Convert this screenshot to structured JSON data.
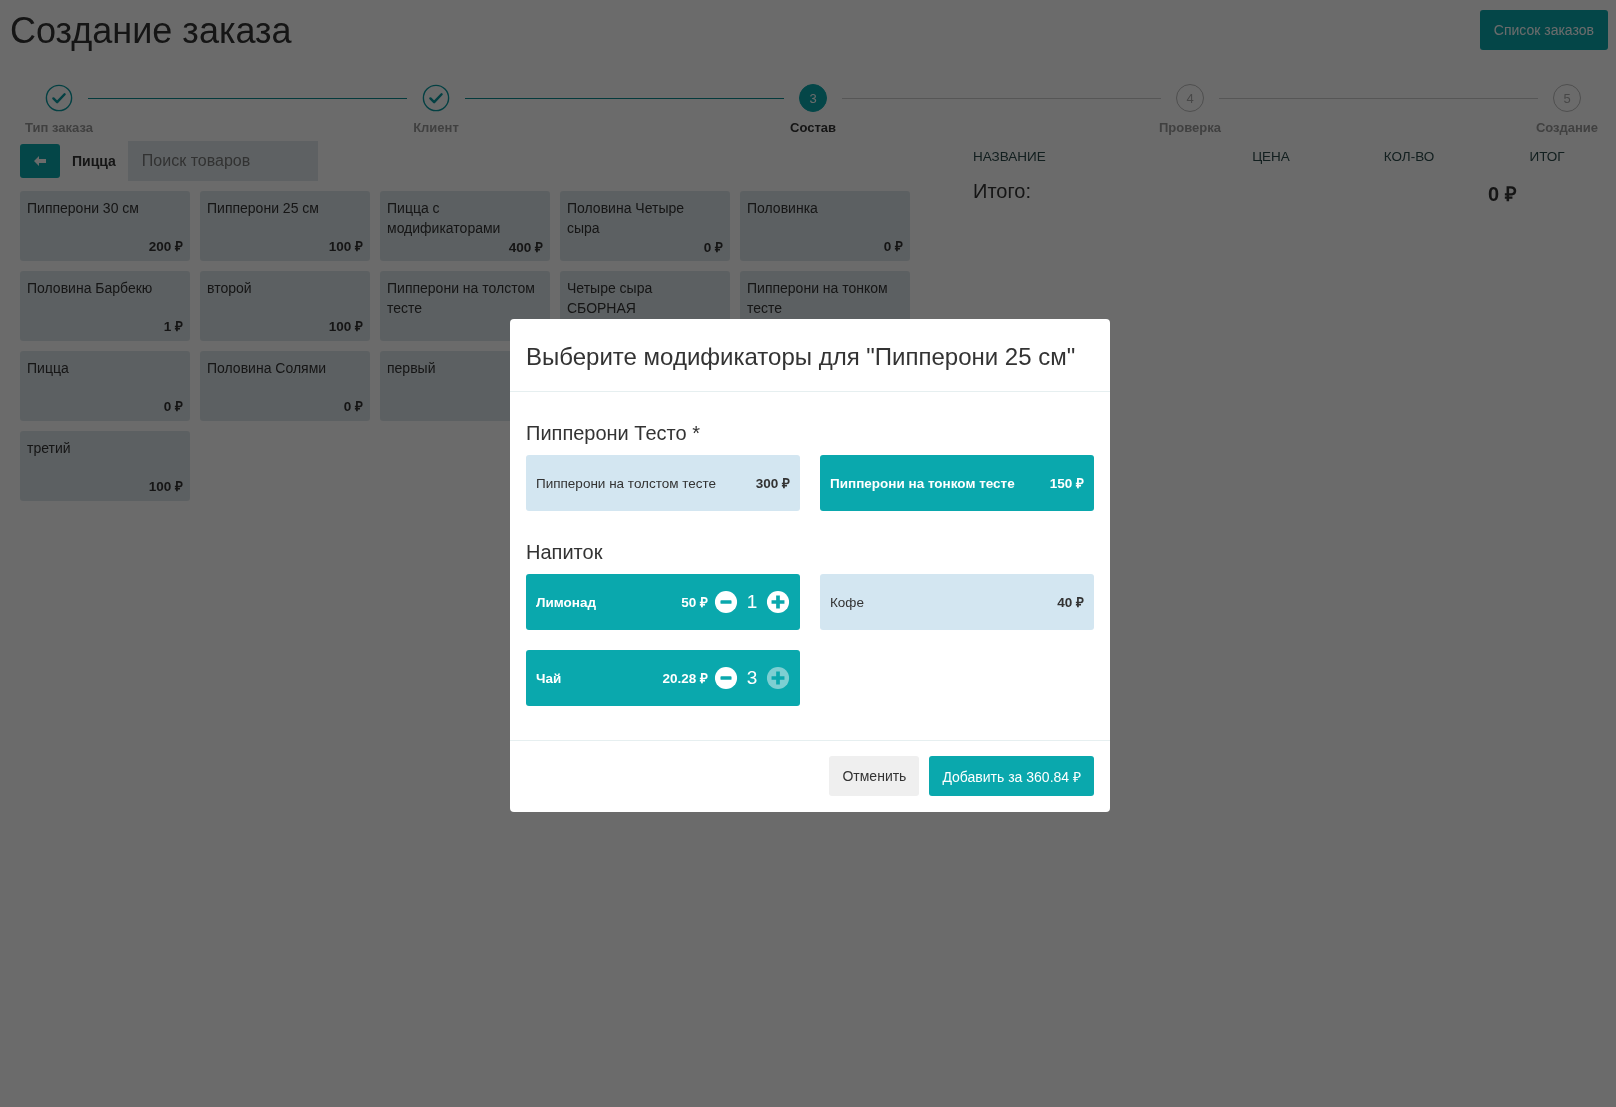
{
  "page": {
    "title": "Создание заказа",
    "orders_button": "Список заказов"
  },
  "stepper": [
    {
      "label": "Тип заказа",
      "completed": true,
      "selected": false
    },
    {
      "label": "Клиент",
      "completed": true,
      "selected": false
    },
    {
      "label": "Состав",
      "number": "3",
      "completed": false,
      "selected": true
    },
    {
      "label": "Проверка",
      "number": "4",
      "completed": false,
      "selected": false
    },
    {
      "label": "Создание",
      "number": "5",
      "completed": false,
      "selected": false
    }
  ],
  "catalog": {
    "category": "Пицца",
    "search": {
      "placeholder": "Поиск товаров"
    },
    "product_rows": [
      [
        {
          "name": "Пипперони 30 см",
          "price": "200 ₽"
        },
        {
          "name": "Пипперони 25 см",
          "price": "100 ₽"
        },
        {
          "name": "Пицца с модификаторами",
          "price": "400 ₽"
        },
        {
          "name": "Половина Четыре сыра",
          "price": "0 ₽"
        },
        {
          "name": "Половинка",
          "price": "0 ₽"
        }
      ],
      [
        {
          "name": "Половина Барбекю",
          "price": "1 ₽"
        },
        {
          "name": "второй",
          "price": "100 ₽"
        },
        {
          "name": "Пипперони на толстом тесте"
        },
        {
          "name": "Четыре сыра СБОРНАЯ"
        },
        {
          "name": "Пипперони на тонком тесте"
        }
      ],
      [
        {
          "name": "Пицца",
          "price": "0 ₽"
        },
        {
          "name": "Половина Солями",
          "price": "0 ₽"
        },
        {
          "name": "первый"
        }
      ],
      [
        {
          "name": "третий",
          "price": "100 ₽"
        }
      ]
    ]
  },
  "cart": {
    "columns": [
      "НАЗВАНИЕ",
      "ЦЕНА",
      "КОЛ-ВО",
      "ИТОГ"
    ],
    "total_label": "Итого:",
    "total": "0 ₽"
  },
  "modal": {
    "title": "Выберите модификаторы для \"Пипперони 25 см\"",
    "groups": [
      {
        "title": "Пипперони Тесто *",
        "options": [
          {
            "name": "Пипперони на толстом тесте",
            "price": "300 ₽",
            "selected": false
          },
          {
            "name": "Пипперони на тонком тесте",
            "price": "150 ₽",
            "selected": true
          }
        ]
      },
      {
        "title": "Напиток",
        "options": [
          {
            "name": "Лимонад",
            "price": "50 ₽",
            "selected": true,
            "quantity": "1",
            "plus_disabled": false
          },
          {
            "name": "Кофе",
            "price": "40 ₽",
            "selected": false
          },
          {
            "name": "Чай",
            "price": "20.28 ₽",
            "selected": true,
            "quantity": "3",
            "plus_disabled": true
          }
        ]
      }
    ],
    "buttons": [
      {
        "label": "Отменить",
        "kind": "secondary"
      },
      {
        "label": "Добавить за 360.84 ₽",
        "kind": "primary"
      }
    ]
  }
}
